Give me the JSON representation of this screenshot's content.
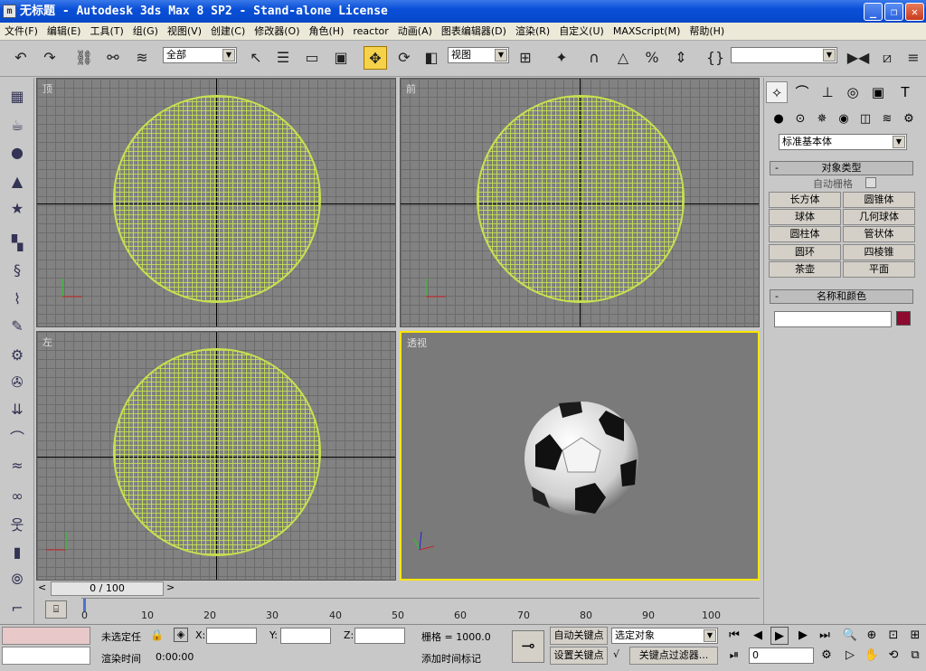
{
  "window": {
    "title": "无标题  - Autodesk 3ds Max 8 SP2  - Stand-alone License",
    "minimize": "_",
    "restore": "❐",
    "close": "✕"
  },
  "menu": [
    "文件(F)",
    "编辑(E)",
    "工具(T)",
    "组(G)",
    "视图(V)",
    "创建(C)",
    "修改器(O)",
    "角色(H)",
    "reactor",
    "动画(A)",
    "图表编辑器(D)",
    "渲染(R)",
    "自定义(U)",
    "MAXScript(M)",
    "帮助(H)"
  ],
  "toolbar": {
    "selection_filter": "全部",
    "ref_coord": "视图",
    "named_selection": ""
  },
  "viewports": {
    "top": "顶",
    "front": "前",
    "left": "左",
    "perspective": "透视"
  },
  "command_panel": {
    "category": "标准基本体",
    "object_type_header": "对象类型",
    "autogrid": "自动栅格",
    "buttons": [
      "长方体",
      "圆锥体",
      "球体",
      "几何球体",
      "圆柱体",
      "管状体",
      "圆环",
      "四棱锥",
      "茶壶",
      "平面"
    ],
    "name_color_header": "名称和颜色",
    "object_color": "#8e0a2e"
  },
  "timeline": {
    "frame": "0 / 100",
    "ticks": [
      "0",
      "10",
      "20",
      "30",
      "40",
      "50",
      "60",
      "70",
      "80",
      "90",
      "100"
    ]
  },
  "status": {
    "selection": "未选定任",
    "render_time_label": "渲染时间",
    "render_time": "0:00:00",
    "x_label": "X:",
    "y_label": "Y:",
    "z_label": "Z:",
    "grid": "栅格 = 1000.0",
    "add_time_tag": "添加时间标记",
    "auto_key": "自动关键点",
    "set_key": "设置关键点",
    "selected_object": "选定对象",
    "key_filters": "关键点过滤器...",
    "current_frame": "0"
  }
}
